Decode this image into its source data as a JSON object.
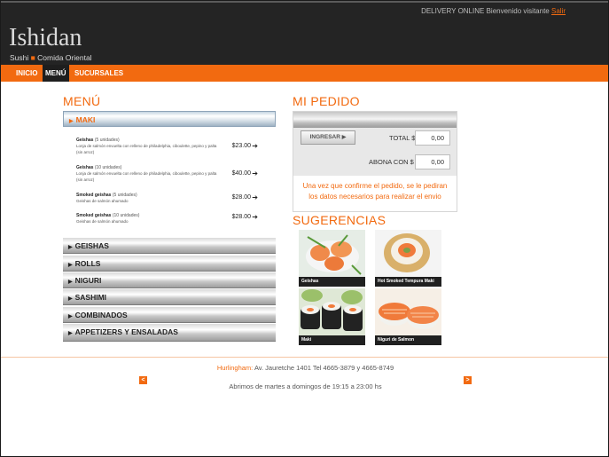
{
  "header": {
    "delivery_text": "DELIVERY ONLINE",
    "welcome_text": "Bienvenido visitante",
    "logout_link": "Salir",
    "logo": "Ishidan",
    "tagline_left": "Sushi",
    "tagline_dot": "■",
    "tagline_right": "Comida Oriental"
  },
  "nav": {
    "items": [
      {
        "label": "INICIO"
      },
      {
        "label": "MENÚ"
      },
      {
        "label": "SUCURSALES"
      }
    ],
    "active_item": "MENÚ"
  },
  "menu": {
    "title": "MENÚ",
    "active_category": "MAKI",
    "items": [
      {
        "name": "Geishas",
        "unit": "(5 unidades)",
        "desc": "Lonja de salmón envuelta con relleno de philadelphia, ciboulette, pepino y palta (sin arroz)",
        "price": "$23.00"
      },
      {
        "name": "Geishas",
        "unit": "(10 unidades)",
        "desc": "Lonja de salmón envuelta con relleno de philadelphia, ciboulette, pepino y palta (sin arroz)",
        "price": "$40.00"
      },
      {
        "name": "Smoked geishas",
        "unit": "(5 unidades)",
        "desc": "Geishas de salmón ahumado",
        "price": "$28.00"
      },
      {
        "name": "Smoked geishas",
        "unit": "(10 unidades)",
        "desc": "Geishas de salmón ahumado",
        "price": "$28.00"
      }
    ],
    "categories": [
      "GEISHAS",
      "ROLLS",
      "NIGURI",
      "SASHIMI",
      "COMBINADOS",
      "APPETIZERS Y ENSALADAS"
    ]
  },
  "order": {
    "title": "MI PEDIDO",
    "ingresar_label": "INGRESAR",
    "total_label": "TOTAL $",
    "total_value": "0,00",
    "abona_label": "ABONA CON $",
    "abona_value": "0,00",
    "message_line1": "Una vez que confirme el pedido, se le pediran",
    "message_line2": "los datos necesarios para realizar el envio"
  },
  "suggestions": {
    "title": "SUGERENCIAS",
    "items": [
      {
        "caption": "Geishas",
        "icon": "geishas-photo"
      },
      {
        "caption": "Hot Smoked Tempura Maki",
        "icon": "tempura-maki-photo"
      },
      {
        "caption": "Maki",
        "icon": "maki-photo"
      },
      {
        "caption": "Niguri de Salmon",
        "icon": "niguri-salmon-photo"
      }
    ]
  },
  "footer": {
    "city": "Hurlingham:",
    "address": "Av. Jauretche 1401 Tel 4665-3879 y 4665-8749",
    "hours": "Abrimos de martes a domingos de 19:15 a 23:00 hs",
    "prev_icon": "<",
    "next_icon": ">"
  },
  "colors": {
    "accent": "#f26a10",
    "header_bg": "#242424"
  }
}
